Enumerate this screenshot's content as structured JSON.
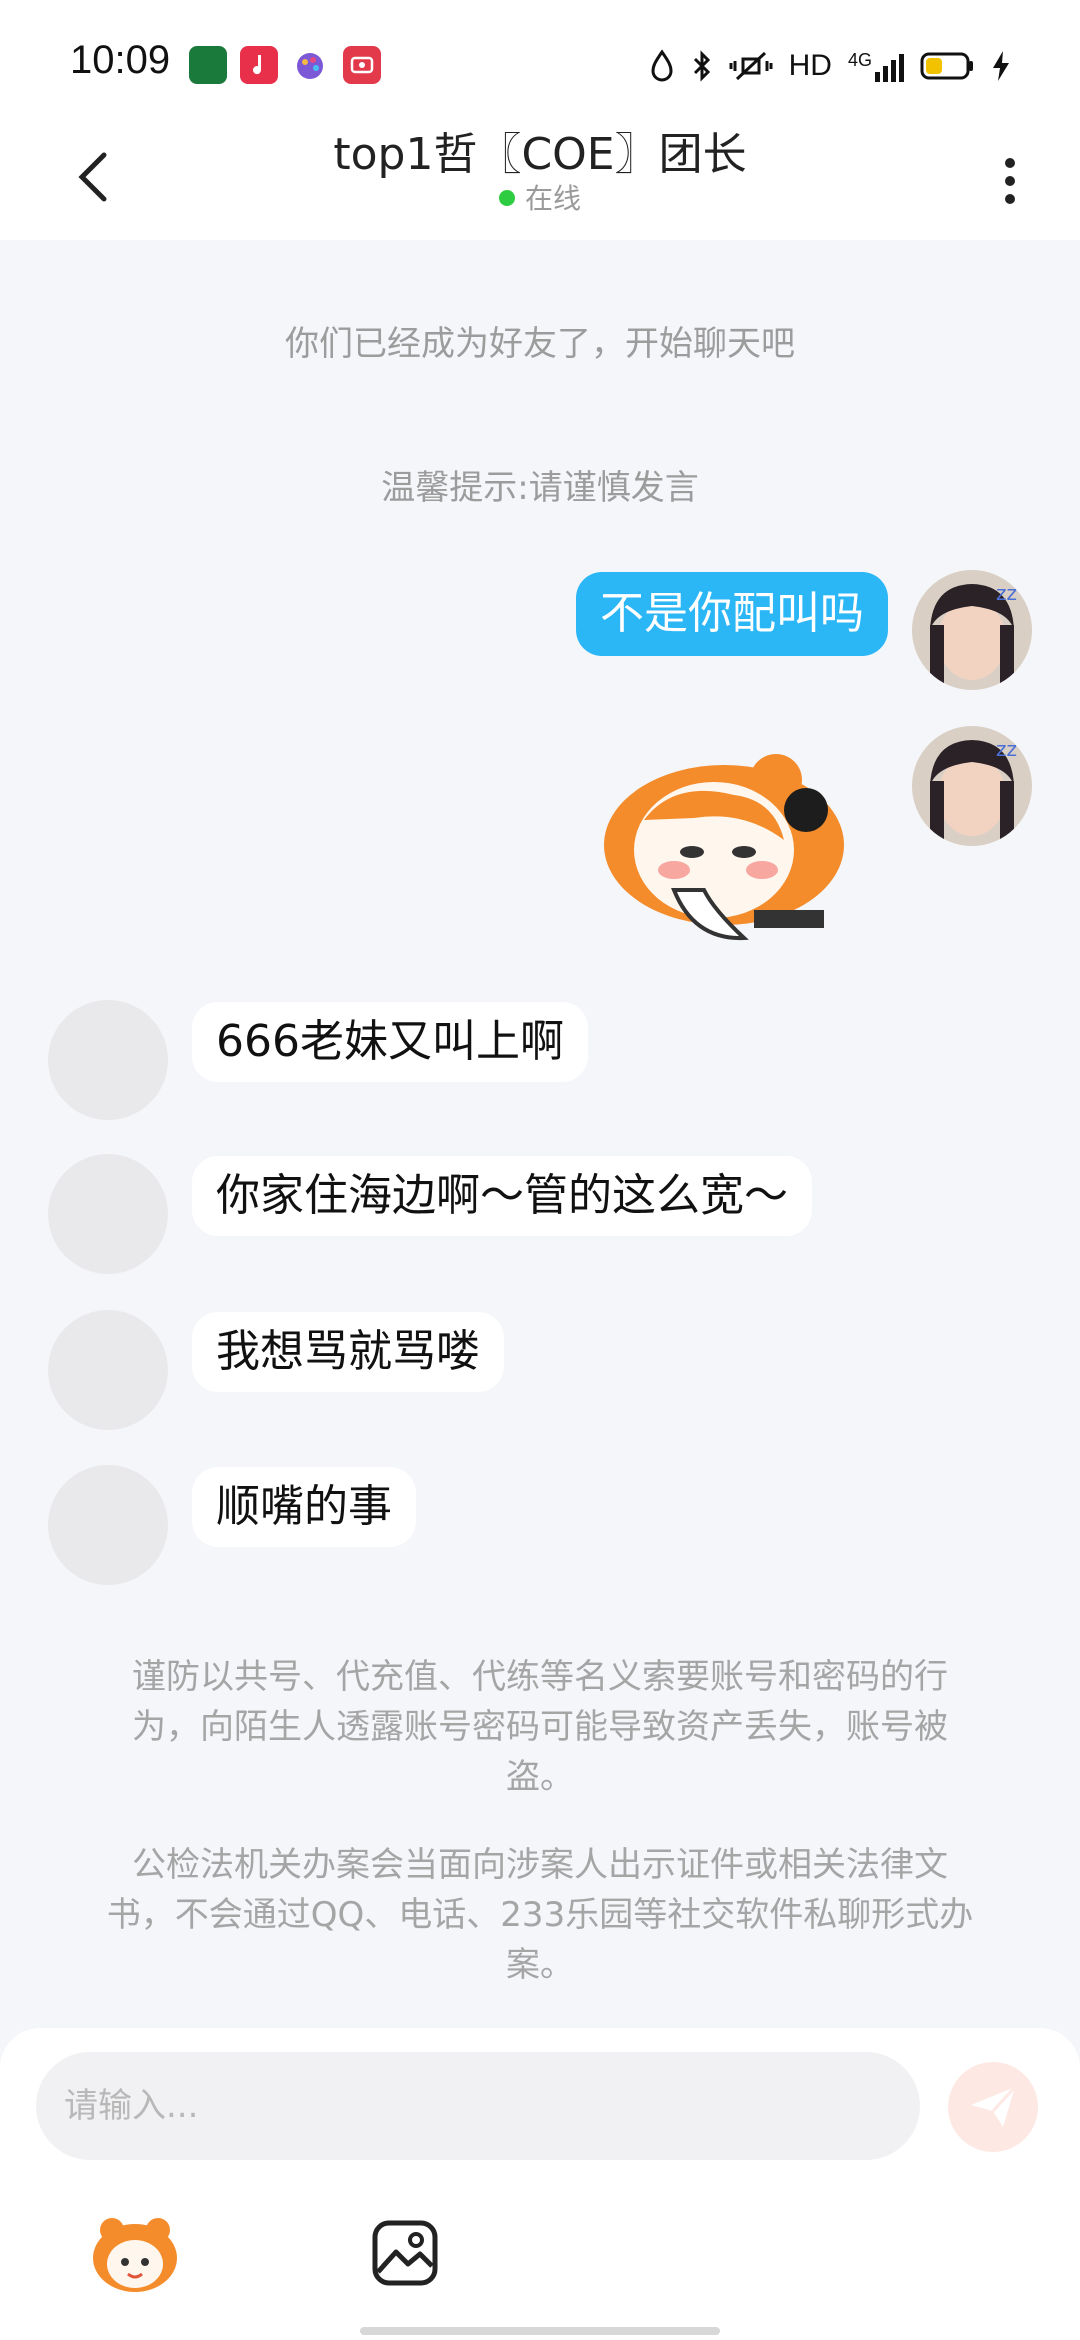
{
  "status_bar": {
    "time": "10:09",
    "network": "HD",
    "signal": "4G",
    "icons": [
      "oppo-app-icon",
      "music-app-icon",
      "paint-app-icon",
      "screen-record-icon",
      "data-saver-icon",
      "bluetooth-icon",
      "vibrate-icon",
      "signal-icon",
      "battery-icon",
      "charging-icon"
    ]
  },
  "header": {
    "title": "top1哲〖COE〗团长",
    "status": "在线",
    "back_icon": "chevron-left-icon",
    "more_icon": "more-vertical-icon"
  },
  "system_messages": {
    "friend_notice": "你们已经成为好友了，开始聊天吧",
    "tip": "温馨提示:请谨慎发言"
  },
  "messages": [
    {
      "side": "mine",
      "type": "text",
      "text": "不是你配叫吗"
    },
    {
      "side": "mine",
      "type": "sticker",
      "sticker": "crying-girl-sticker"
    },
    {
      "side": "other",
      "type": "text",
      "text": "666老妹又叫上啊"
    },
    {
      "side": "other",
      "type": "text",
      "text": "你家住海边啊～管的这么宽～"
    },
    {
      "side": "other",
      "type": "text",
      "text": "我想骂就骂喽"
    },
    {
      "side": "other",
      "type": "text",
      "text": "顺嘴的事"
    }
  ],
  "warnings": {
    "account": "谨防以共号、代充值、代练等名义索要账号和密码的行为，向陌生人透露账号密码可能导致资产丢失，账号被盗。",
    "police": "公检法机关办案会当面向涉案人出示证件或相关法律文书，不会通过QQ、电话、233乐园等社交软件私聊形式办案。"
  },
  "input": {
    "placeholder": "请输入...",
    "value": ""
  },
  "toolbar": {
    "emoji_icon": "sticker-emoji-icon",
    "image_icon": "image-icon",
    "send_icon": "send-icon"
  },
  "colors": {
    "accent_blue": "#2bb6f6",
    "background": "#f4f6fa",
    "online_green": "#2ecc40",
    "send_disabled": "#fde8e4"
  }
}
